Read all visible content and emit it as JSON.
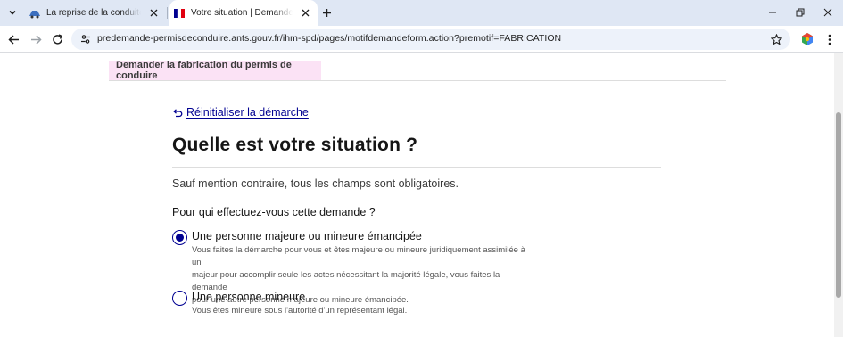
{
  "browser": {
    "tabs": [
      {
        "title": "La reprise de la conduite autom",
        "active": false
      },
      {
        "title": "Votre situation | Demander la fa",
        "active": true
      }
    ],
    "url": "predemande-permisdeconduire.ants.gouv.fr/ihm-spd/pages/motifdemandeform.action?premotif=FABRICATION",
    "colors": {
      "tabstrip": "#dfe7f4",
      "omnibox": "#edf2fa"
    }
  },
  "page": {
    "step_title": "Demander la fabrication du permis de conduire",
    "reset_link": "Réinitialiser la démarche",
    "heading": "Quelle est votre situation ?",
    "mandatory_note": "Sauf mention contraire, tous les champs sont obligatoires.",
    "question": "Pour qui effectuez-vous cette demande ?",
    "options": [
      {
        "label": "Une personne majeure ou mineure émancipée",
        "hint_lines": [
          "Vous faites la démarche pour vous et êtes majeure ou mineure juridiquement assimilée à un",
          "majeur pour accomplir seule les actes nécessitant la majorité légale, vous faites la demande",
          "pour une autre personne majeure ou mineure émancipée."
        ],
        "selected": true
      },
      {
        "label": "Une personne mineure",
        "hint_lines": [
          "Vous êtes mineure sous l'autorité d'un représentant légal."
        ],
        "selected": false
      }
    ],
    "colors": {
      "accent": "#000091",
      "step_band": "#fbe2f5"
    }
  }
}
